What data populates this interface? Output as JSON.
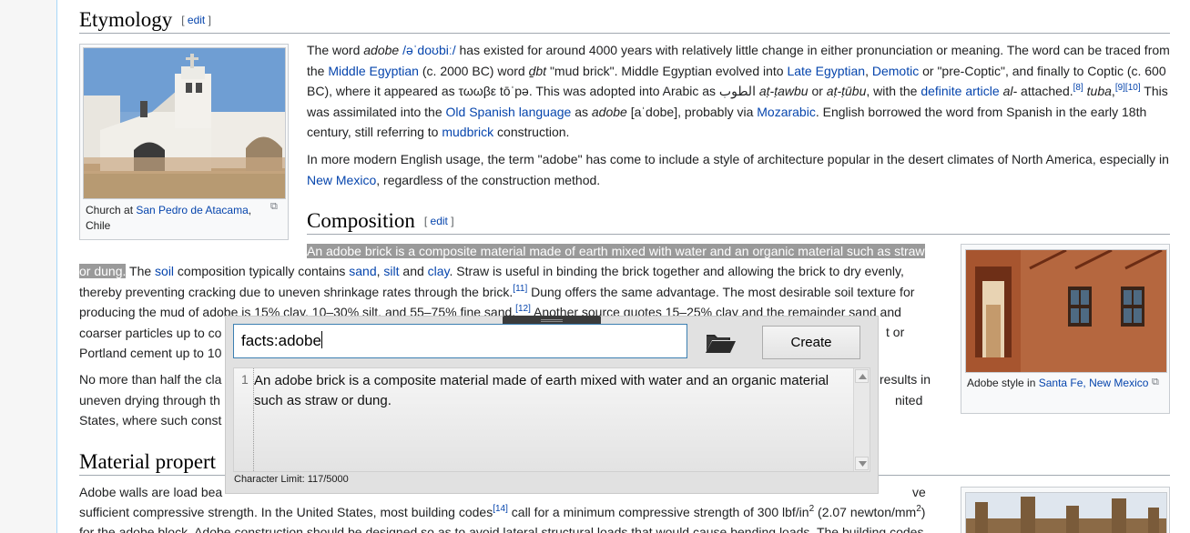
{
  "etymology": {
    "heading": "Etymology",
    "edit_open": "[ ",
    "edit_link": "edit",
    "edit_close": " ]",
    "para1": {
      "t1": "The word ",
      "i1": "adobe",
      "t2": " ",
      "l1": "/əˈdoʊbiː/",
      "t3": " has existed for around 4000 years with relatively little change in either pronunciation or meaning. The word can be traced from the ",
      "l2": "Middle Egyptian",
      "t4": " (c. 2000 BC) word ",
      "i2": "ḏbt",
      "t5": " \"mud brick\". Middle Egyptian evolved into ",
      "l3": "Late Egyptian",
      "t6": ", ",
      "l4": "Demotic",
      "t7": " or \"pre-Coptic\", and finally to Coptic (c. 600 BC), where it appeared as τωωβε tōˈpə. This was adopted into Arabic as الطوب ",
      "i3": "aṭ-ṭawbu",
      "t8": " or ",
      "i4": "aṭ-ṭūbu",
      "t9": ", with the ",
      "l5": "definite article",
      "t10": " ",
      "i5": "al-",
      "t11": " attached.",
      "s1": "[8]",
      "t12": " ",
      "i6": "tuba",
      "t13": ",",
      "s2": "[9][10]",
      "t14": " This was assimilated into the ",
      "l6": "Old Spanish language",
      "t15": " as ",
      "i7": "adobe",
      "t16": " [aˈdobe], probably via ",
      "l7": "Mozarabic",
      "t17": ". English borrowed the word from Spanish in the early 18th century, still referring to ",
      "l8": "mudbrick",
      "t18": " construction."
    },
    "para2": {
      "t1": "In more modern English usage, the term \"adobe\" has come to include a style of architecture popular in the desert climates of North America, especially in ",
      "l1": "New Mexico",
      "t2": ", regardless of the construction method."
    },
    "church_caption": {
      "t1": "Church at ",
      "l1": "San Pedro de Atacama",
      "t2": ", Chile"
    }
  },
  "composition": {
    "heading": "Composition",
    "edit_open": "[ ",
    "edit_link": "edit",
    "edit_close": " ]",
    "para1": {
      "hl1": "An adobe brick is a composite material made of earth mixed with water and an organic material such as straw",
      "hl2": "or dung.",
      "t1": " The ",
      "l1": "soil",
      "t2": " composition typically contains ",
      "l2": "sand",
      "t3": ", ",
      "l3": "silt",
      "t4": " and ",
      "l4": "clay",
      "t5": ". Straw is useful in binding the brick together and allowing the brick to dry evenly, thereby preventing cracking due to uneven shrinkage rates through the brick.",
      "s1": "[11]",
      "t6": " Dung offers the same advantage. The most desirable soil texture for producing the mud of adobe is 15% clay, 10–30% silt, and 55–75% fine sand.",
      "s2": "[12]",
      "t7": " Another source quotes 15–25% clay and the remainder sand and coarser particles up to co",
      "t8": "t or",
      "t9": "Portland cement up to 10"
    },
    "para2": {
      "t1": "No more than half the cla",
      "t2": "results in",
      "t3": "uneven drying through th",
      "t4": "nited",
      "t5": "States, where such const"
    },
    "adobe_caption": {
      "t1": "Adobe style in ",
      "l1": "Santa Fe, New Mexico"
    }
  },
  "material": {
    "heading": "Material propert",
    "para1": {
      "t1": "Adobe walls are load bea",
      "t2": "ve",
      "t3": "sufficient compressive strength. In the United States, most building codes",
      "s1": "[14]",
      "t4": " call for a minimum compressive strength of 300 lbf/in",
      "s2": "2",
      "t5": " (2.07 newton/mm",
      "s3": "2",
      "t6": ")",
      "t7": "for the adobe block. Adobe construction should be designed so as to avoid lateral structural loads that would cause bending loads. The building codes"
    }
  },
  "dialog": {
    "input_value": "facts:adobe",
    "create_label": "Create",
    "line_number": "1",
    "editor_text": "An adobe brick is a composite material made of earth mixed with water and an organic material such as straw or dung.",
    "char_limit": "Character Limit: 117/5000",
    "folder_icon": "folder-open-icon"
  },
  "colors": {
    "link": "#0645ad",
    "highlight": "#9a9a9a",
    "input_border": "#3c7fb1"
  }
}
